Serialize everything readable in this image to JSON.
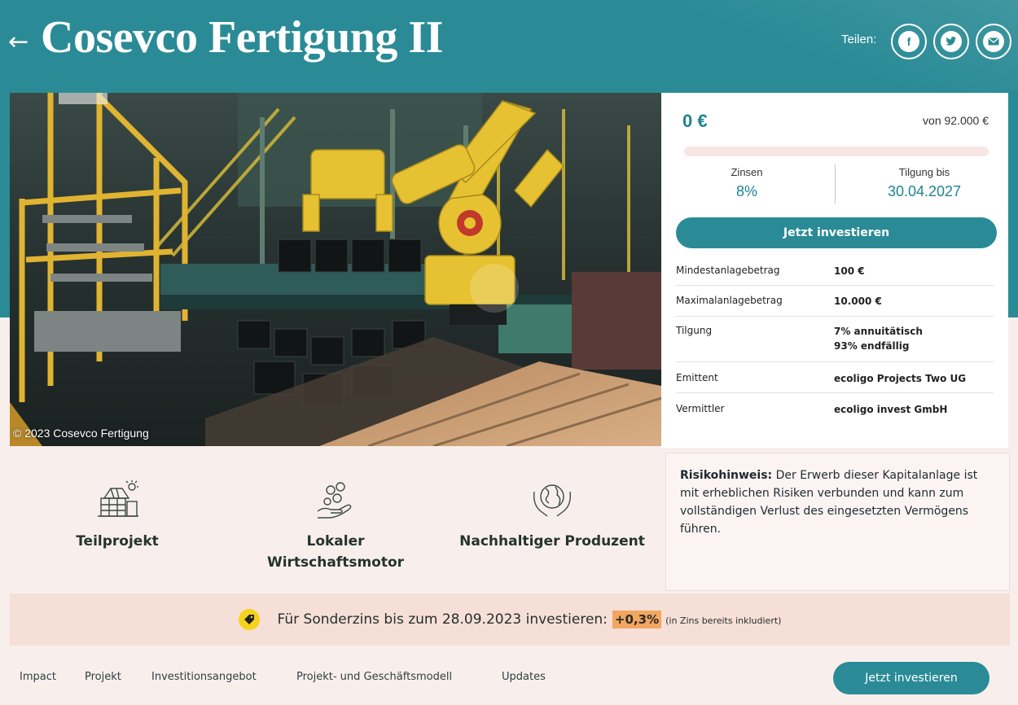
{
  "header": {
    "back_icon": "arrow-left-icon",
    "title": "Cosevco Fertigung II",
    "share_label": "Teilen:",
    "share_buttons": [
      {
        "icon": "facebook-icon",
        "glyph": "f"
      },
      {
        "icon": "twitter-icon"
      },
      {
        "icon": "email-icon"
      }
    ]
  },
  "photo": {
    "credit": "© 2023 Cosevco Fertigung"
  },
  "investment": {
    "amount": "0 €",
    "goal": "von 92.000 €",
    "progress_fraction": 0,
    "interest_label": "Zinsen",
    "interest_value": "8%",
    "repayment_label": "Tilgung bis",
    "repayment_value": "30.04.2027",
    "cta": "Jetzt investieren",
    "facts": [
      {
        "key": "Mindestanlagebetrag",
        "value": "100 €",
        "value2": ""
      },
      {
        "key": "Maximalanlagebetrag",
        "value": "10.000 €",
        "value2": ""
      },
      {
        "key": "Tilgung",
        "value": "7% annuitätisch",
        "value2": "93% endfällig"
      },
      {
        "key": "Emittent",
        "value": "ecoligo Projects Two UG",
        "value2": ""
      },
      {
        "key": "Vermittler",
        "value": "ecoligo invest GmbH",
        "value2": ""
      }
    ]
  },
  "features": [
    {
      "icon": "solar-building-icon",
      "line1": "Teilprojekt",
      "line2": ""
    },
    {
      "icon": "hand-coins-icon",
      "line1": "Lokaler",
      "line2": "Wirtschaftsmotor"
    },
    {
      "icon": "hands-globe-icon",
      "line1": "Nachhaltiger Produzent",
      "line2": ""
    }
  ],
  "risk": {
    "label": "Risikohinweis:",
    "text": " Der Erwerb dieser Kapitalanlage ist mit erheblichen Risiken verbunden und kann zum vollständigen Verlust des eingesetzten Vermögens führen."
  },
  "promo": {
    "icon": "tag-icon",
    "text": "Für Sonderzins bis zum 28.09.2023 investieren:",
    "badge": "+0,3%",
    "note": "(in Zins bereits inkludiert)"
  },
  "nav": {
    "links": [
      "Impact",
      "Projekt",
      "Investitionsangebot",
      "Projekt- und Geschäftsmodell",
      "Updates"
    ],
    "cta": "Jetzt investieren"
  },
  "colors": {
    "brand_teal": "#2a8b96",
    "accent_teal_text": "#1f8494",
    "cream": "#f8efec",
    "promo_bg": "#f6dfd7",
    "badge_orange": "#f2a65f",
    "tag_yellow": "#f5d31a"
  }
}
